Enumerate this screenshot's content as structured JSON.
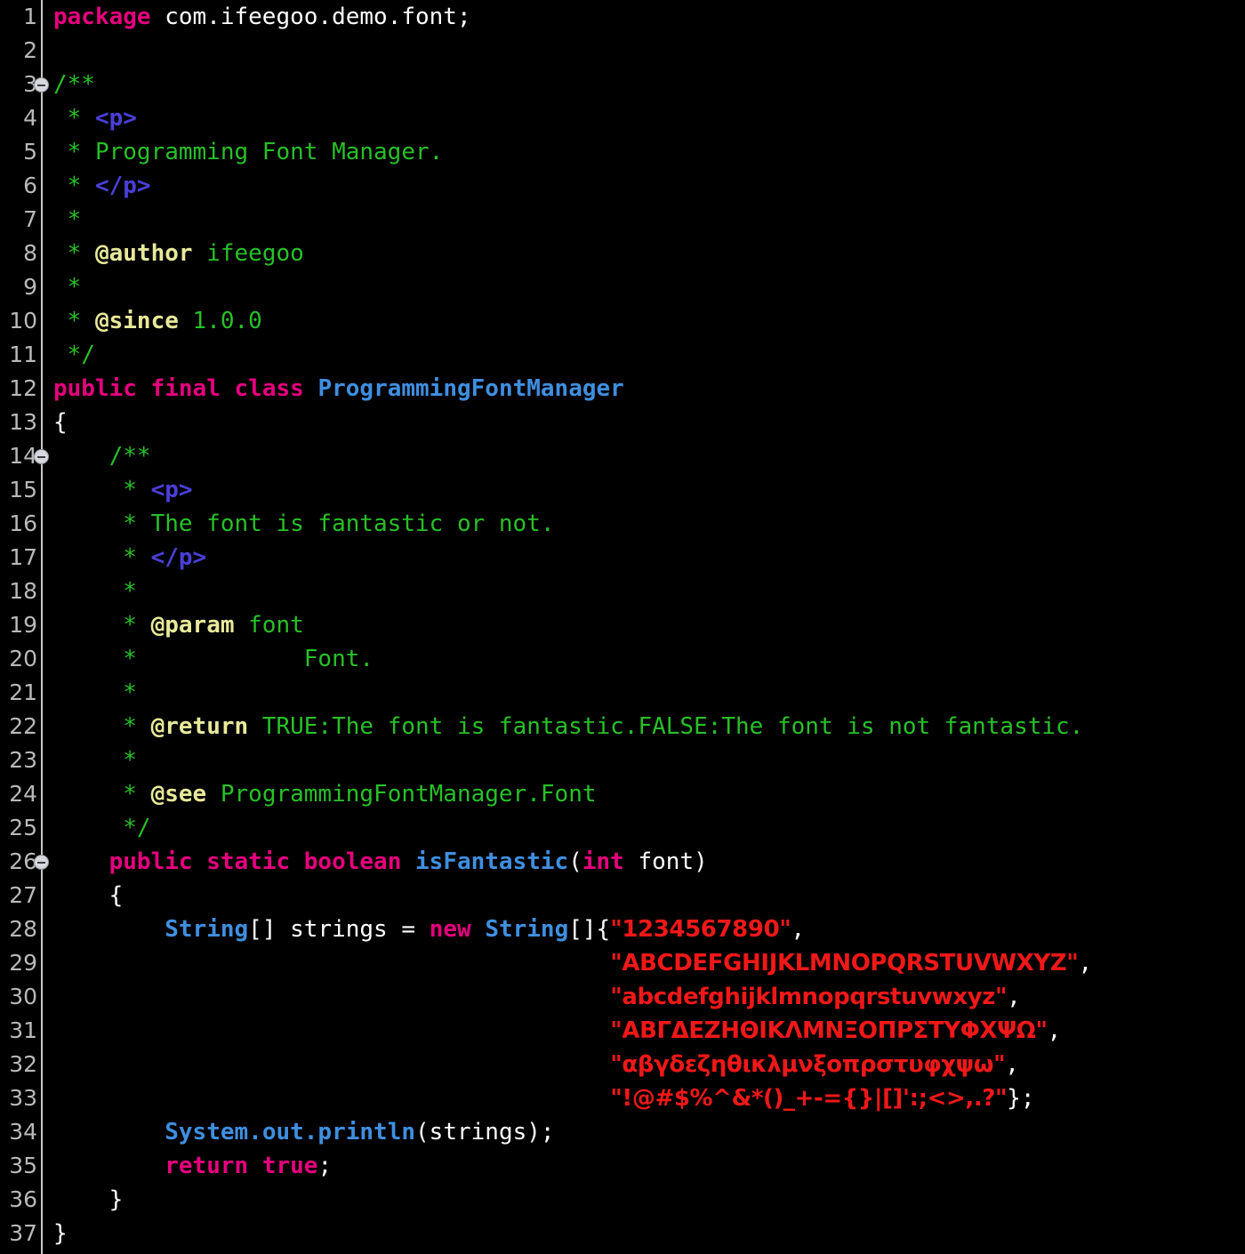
{
  "editor": {
    "language": "java",
    "theme_background": "#000000",
    "gutter_separator_color": "#c8c8c8",
    "line_number_color": "#b9b9b9",
    "total_lines": 37,
    "fold_marker_lines": [
      3,
      14,
      26
    ],
    "colors": {
      "keyword": "#e6007e",
      "type": "#3f8fe0",
      "method": "#3f8fe0",
      "comment": "#28c028",
      "javadoc_tag": "#e8e89a",
      "javadoc_html_tag": "#4a3fd8",
      "string": "#f01818",
      "plain_text": "#ffffff"
    }
  },
  "line_numbers": [
    "1",
    "2",
    "3",
    "4",
    "5",
    "6",
    "7",
    "8",
    "9",
    "10",
    "11",
    "12",
    "13",
    "14",
    "15",
    "16",
    "17",
    "18",
    "19",
    "20",
    "21",
    "22",
    "23",
    "24",
    "25",
    "26",
    "27",
    "28",
    "29",
    "30",
    "31",
    "32",
    "33",
    "34",
    "35",
    "36",
    "37"
  ],
  "code_lines": [
    {
      "n": 1,
      "text": "package com.ifeegoo.demo.font;"
    },
    {
      "n": 2,
      "text": ""
    },
    {
      "n": 3,
      "text": "/**"
    },
    {
      "n": 4,
      "text": " * <p>"
    },
    {
      "n": 5,
      "text": " * Programming Font Manager."
    },
    {
      "n": 6,
      "text": " * </p>"
    },
    {
      "n": 7,
      "text": " *"
    },
    {
      "n": 8,
      "text": " * @author ifeegoo"
    },
    {
      "n": 9,
      "text": " *"
    },
    {
      "n": 10,
      "text": " * @since 1.0.0"
    },
    {
      "n": 11,
      "text": " */"
    },
    {
      "n": 12,
      "text": "public final class ProgrammingFontManager"
    },
    {
      "n": 13,
      "text": "{"
    },
    {
      "n": 14,
      "text": "    /**"
    },
    {
      "n": 15,
      "text": "     * <p>"
    },
    {
      "n": 16,
      "text": "     * The font is fantastic or not."
    },
    {
      "n": 17,
      "text": "     * </p>"
    },
    {
      "n": 18,
      "text": "     *"
    },
    {
      "n": 19,
      "text": "     * @param font"
    },
    {
      "n": 20,
      "text": "     *            Font."
    },
    {
      "n": 21,
      "text": "     *"
    },
    {
      "n": 22,
      "text": "     * @return TRUE:The font is fantastic.FALSE:The font is not fantastic."
    },
    {
      "n": 23,
      "text": "     *"
    },
    {
      "n": 24,
      "text": "     * @see ProgrammingFontManager.Font"
    },
    {
      "n": 25,
      "text": "     */"
    },
    {
      "n": 26,
      "text": "    public static boolean isFantastic(int font)"
    },
    {
      "n": 27,
      "text": "    {"
    },
    {
      "n": 28,
      "text": "        String[] strings = new String[]{\"1234567890\","
    },
    {
      "n": 29,
      "text": "                                        \"ABCDEFGHIJKLMNOPQRSTUVWXYZ\","
    },
    {
      "n": 30,
      "text": "                                        \"abcdefghijklmnopqrstuvwxyz\","
    },
    {
      "n": 31,
      "text": "                                        \"ΑΒΓΔΕΖΗΘΙΚΛΜΝΞΟΠΡΣΤΥΦΧΨΩ\","
    },
    {
      "n": 32,
      "text": "                                        \"αβγδεζηθικλμνξοπρστυφχψω\","
    },
    {
      "n": 33,
      "text": "                                        \"!@#$%^&*()_+-={}|[]':;<>,.?\"};"
    },
    {
      "n": 34,
      "text": "        System.out.println(strings);"
    },
    {
      "n": 35,
      "text": "        return true;"
    },
    {
      "n": 36,
      "text": "    }"
    },
    {
      "n": 37,
      "text": "}"
    }
  ],
  "tokens": {
    "keywords": [
      "package",
      "public",
      "final",
      "class",
      "static",
      "boolean",
      "int",
      "new",
      "return",
      "true"
    ],
    "identifiers": [
      "com.ifeegoo.demo.font",
      "ProgrammingFontManager",
      "isFantastic",
      "font",
      "String",
      "strings",
      "System",
      "out",
      "println"
    ],
    "javadoc_tags": [
      "@author",
      "@since",
      "@param",
      "@return",
      "@see"
    ],
    "javadoc_html_tags": [
      "<p>",
      "</p>"
    ],
    "javadoc_text": [
      "Programming Font Manager.",
      "ifeegoo",
      "1.0.0",
      "The font is fantastic or not.",
      "font",
      "Font.",
      "TRUE:The font is fantastic.FALSE:The font is not fantastic.",
      "ProgrammingFontManager.Font"
    ],
    "string_literals": [
      "1234567890",
      "ABCDEFGHIJKLMNOPQRSTUVWXYZ",
      "abcdefghijklmnopqrstuvwxyz",
      "ΑΒΓΔΕΖΗΘΙΚΛΜΝΞΟΠΡΣΤΥΦΧΨΩ",
      "αβγδεζηθικλμνξοπρστυφχψω",
      "!@#$%^&*()_+-={}|[]':;<>,.?"
    ]
  }
}
